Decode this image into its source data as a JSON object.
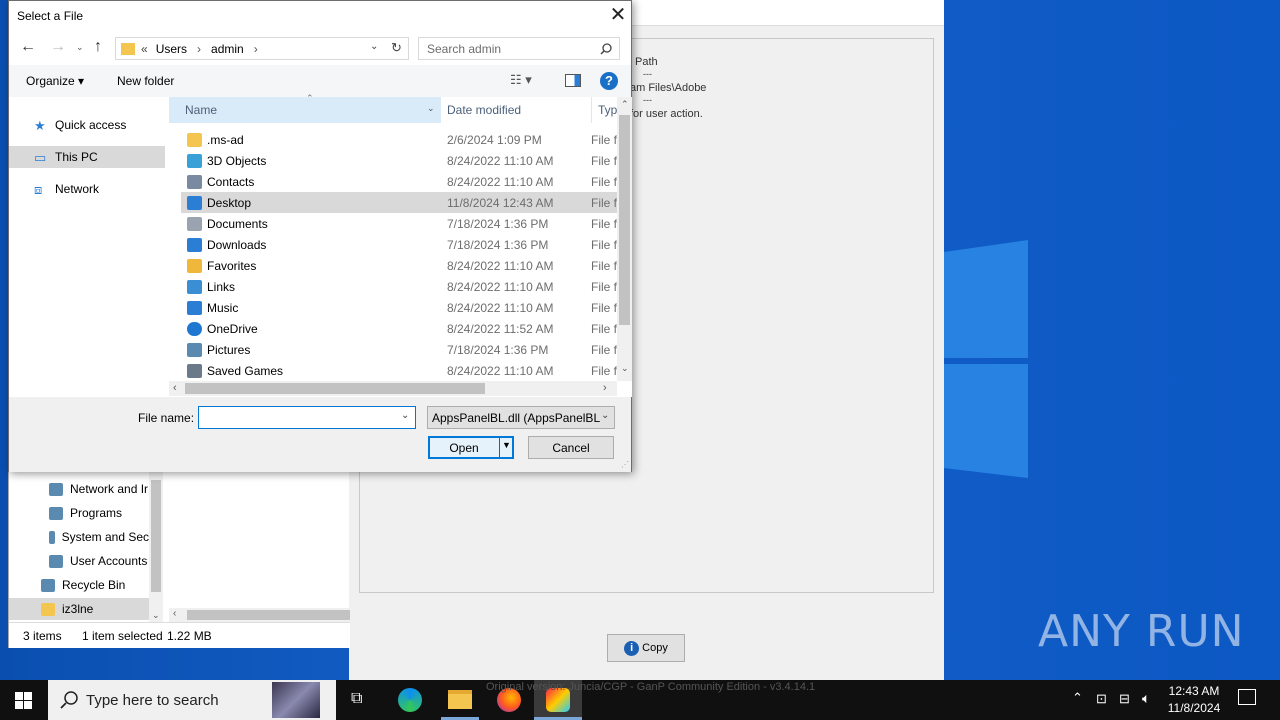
{
  "dialog": {
    "title": "Select a File",
    "address": {
      "prefix": "«",
      "crumbs": [
        "Users",
        "admin"
      ]
    },
    "search_placeholder": "Search admin",
    "organize_label": "Organize ▾",
    "new_folder_label": "New folder",
    "nav": [
      {
        "label": "Quick access",
        "icon": "star-icon"
      },
      {
        "label": "This PC",
        "icon": "computer-icon",
        "selected": true
      },
      {
        "label": "Network",
        "icon": "network-icon"
      }
    ],
    "columns": {
      "name": "Name",
      "date": "Date modified",
      "type": "Type"
    },
    "files": [
      {
        "name": ".ms-ad",
        "date": "2/6/2024 1:09 PM",
        "type": "File f",
        "icon": "folder-icon",
        "color": "#f4c64f"
      },
      {
        "name": "3D Objects",
        "date": "8/24/2022 11:10 AM",
        "type": "File f",
        "icon": "cube-icon",
        "color": "#3aa0d8"
      },
      {
        "name": "Contacts",
        "date": "8/24/2022 11:10 AM",
        "type": "File f",
        "icon": "contacts-icon",
        "color": "#7a8aa0"
      },
      {
        "name": "Desktop",
        "date": "11/8/2024 12:43 AM",
        "type": "File f",
        "icon": "desktop-icon",
        "color": "#2a7fd4",
        "selected": true
      },
      {
        "name": "Documents",
        "date": "7/18/2024 1:36 PM",
        "type": "File f",
        "icon": "document-icon",
        "color": "#9aa4b0"
      },
      {
        "name": "Downloads",
        "date": "7/18/2024 1:36 PM",
        "type": "File f",
        "icon": "download-icon",
        "color": "#2a7fd4"
      },
      {
        "name": "Favorites",
        "date": "8/24/2022 11:10 AM",
        "type": "File f",
        "icon": "star-icon",
        "color": "#f0b83a"
      },
      {
        "name": "Links",
        "date": "8/24/2022 11:10 AM",
        "type": "File f",
        "icon": "link-icon",
        "color": "#3a8fd4"
      },
      {
        "name": "Music",
        "date": "8/24/2022 11:10 AM",
        "type": "File f",
        "icon": "music-icon",
        "color": "#2a7fd4"
      },
      {
        "name": "OneDrive",
        "date": "8/24/2022 11:52 AM",
        "type": "File f",
        "icon": "cloud-icon",
        "color": "#1e78d2"
      },
      {
        "name": "Pictures",
        "date": "7/18/2024 1:36 PM",
        "type": "File f",
        "icon": "pictures-icon",
        "color": "#5a8ab0"
      },
      {
        "name": "Saved Games",
        "date": "8/24/2022 11:10 AM",
        "type": "File f",
        "icon": "games-icon",
        "color": "#6a7a8a"
      }
    ],
    "filename_label": "File name:",
    "filename_value": "",
    "filter_value": "AppsPanelBL.dll (AppsPanelBL.",
    "open_label": "Open",
    "cancel_label": "Cancel"
  },
  "explorer": {
    "items": [
      {
        "label": "Network and Ir",
        "icon": "network-sharing-icon"
      },
      {
        "label": "Programs",
        "icon": "programs-icon"
      },
      {
        "label": "System and Sec",
        "icon": "shield-icon"
      },
      {
        "label": "User Accounts",
        "icon": "users-icon"
      },
      {
        "label": "Recycle Bin",
        "icon": "recycle-bin-icon"
      },
      {
        "label": "iz3lne",
        "icon": "folder-icon"
      }
    ],
    "status": {
      "items": "3 items",
      "selected": "1 item selected",
      "size": "1.22 MB"
    }
  },
  "background_app": {
    "texts": [
      "Path",
      "---",
      "am Files\\Adobe",
      "---",
      "for user action."
    ],
    "copy_label": "Copy",
    "footer": "Original version: Juncia/CGP - GanP Community Edition - v3.4.14.1"
  },
  "watermark": "ANY  RUN",
  "taskbar": {
    "search_placeholder": "Type here to search",
    "time": "12:43 AM",
    "date": "11/8/2024"
  }
}
